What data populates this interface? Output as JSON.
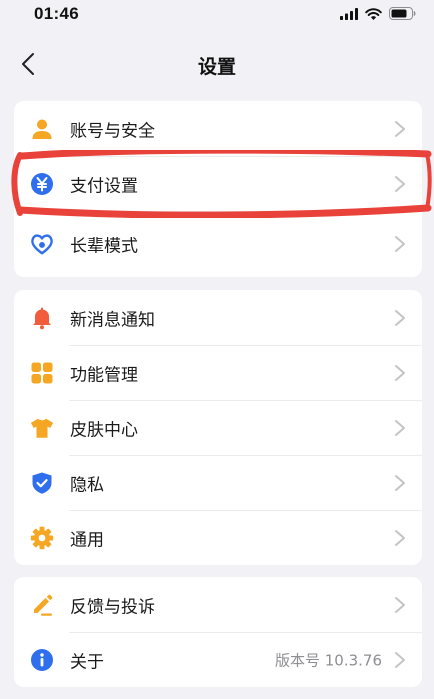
{
  "status_bar": {
    "time": "01:46"
  },
  "header": {
    "title": "设置"
  },
  "groups": [
    {
      "items": [
        {
          "label": "账号与安全",
          "icon": "person-icon"
        },
        {
          "label": "支付设置",
          "icon": "yuan-coin-icon"
        },
        {
          "label": "长辈模式",
          "icon": "heart-hands-icon"
        }
      ]
    },
    {
      "items": [
        {
          "label": "新消息通知",
          "icon": "bell-icon"
        },
        {
          "label": "功能管理",
          "icon": "grid-icon"
        },
        {
          "label": "皮肤中心",
          "icon": "tshirt-icon"
        },
        {
          "label": "隐私",
          "icon": "shield-check-icon"
        },
        {
          "label": "通用",
          "icon": "gear-icon"
        }
      ]
    },
    {
      "items": [
        {
          "label": "反馈与投诉",
          "icon": "pen-icon"
        },
        {
          "label": "关于",
          "icon": "info-icon",
          "value": "版本号 10.3.76"
        }
      ]
    }
  ],
  "colors": {
    "background": "#f2f2f6",
    "orange": "#f5a623",
    "blue": "#2f6fed",
    "red": "#f25c3b",
    "highlight": "#e8423a"
  }
}
